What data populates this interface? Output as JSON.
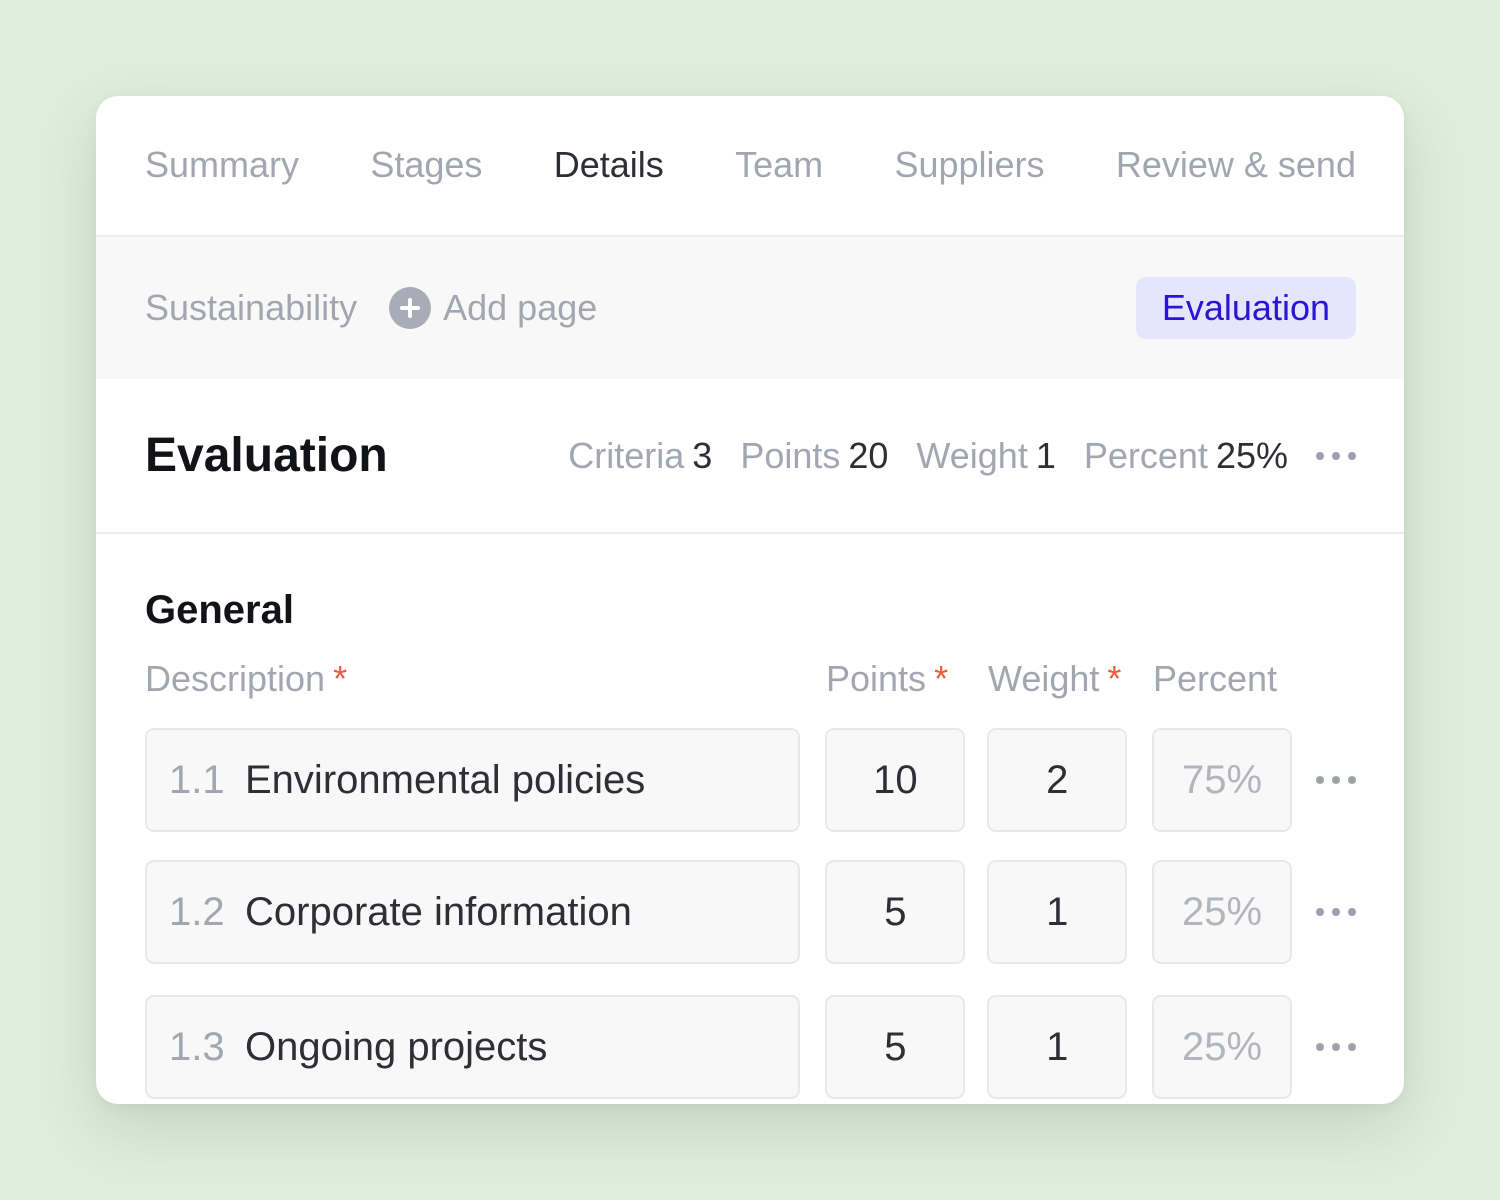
{
  "tabs": [
    {
      "label": "Summary"
    },
    {
      "label": "Stages"
    },
    {
      "label": "Details"
    },
    {
      "label": "Team"
    },
    {
      "label": "Suppliers"
    },
    {
      "label": "Review & send"
    }
  ],
  "active_tab": "Details",
  "subbar": {
    "page": "Sustainability",
    "add_page": "Add page",
    "evaluation_button": "Evaluation"
  },
  "header": {
    "title": "Evaluation",
    "stats": [
      {
        "label": "Criteria",
        "value": "3"
      },
      {
        "label": "Points",
        "value": "20"
      },
      {
        "label": "Weight",
        "value": "1"
      },
      {
        "label": "Percent",
        "value": "25%"
      }
    ]
  },
  "section": {
    "title": "General",
    "columns": {
      "description": "Description",
      "points": "Points",
      "weight": "Weight",
      "percent": "Percent",
      "required_mark": "*"
    },
    "rows": [
      {
        "number": "1.1",
        "description": "Environmental policies",
        "points": "10",
        "weight": "2",
        "percent": "75%"
      },
      {
        "number": "1.2",
        "description": "Corporate information",
        "points": "5",
        "weight": "1",
        "percent": "25%"
      },
      {
        "number": "1.3",
        "description": "Ongoing projects",
        "points": "5",
        "weight": "1",
        "percent": "25%"
      }
    ]
  },
  "colors": {
    "background": "#deeedb",
    "accent": "#2a14d6",
    "accent_bg": "#e5e5fd",
    "required": "#ee5a3c"
  },
  "icons": {
    "add": "plus-circle-icon",
    "more": "more-horizontal-icon"
  }
}
